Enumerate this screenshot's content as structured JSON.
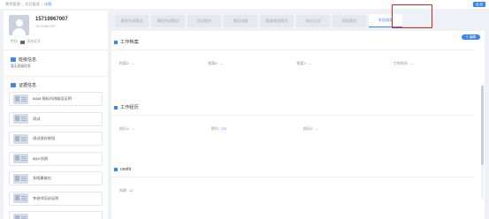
{
  "breadcrumb": [
    "教师管理",
    "学员管理",
    "详情"
  ],
  "top_button": "返 回",
  "profile": {
    "name": "15719967007",
    "phone": "15719967007",
    "gender_label": "性别",
    "tag": "身份证号"
  },
  "class_info": {
    "title": "班级信息",
    "value": "暂无班级信息"
  },
  "cert_info": {
    "title": "证据信息",
    "items": [
      "aqua 指标内测级培证明",
      "测试",
      "测试保存按钮",
      "aiya 执照",
      "多版属能也",
      "李老师培训证明",
      ""
    ]
  },
  "tabs": [
    "课表完成情况",
    "课程完成情况",
    "活动报名",
    "报证进展",
    "套餐使用情况",
    "岗位认证",
    "保险情况",
    "学员档案"
  ],
  "active_tab": 7,
  "edit_label": "编辑",
  "work_file": {
    "title": "工作档案",
    "fields": [
      {
        "label": "档案2:",
        "value": "---"
      },
      {
        "label": "档案4:",
        "value": "---"
      },
      {
        "label": "档案3:",
        "value": "---"
      },
      {
        "label": "工作时间:",
        "value": "---"
      }
    ]
  },
  "work_exp": {
    "title": "工作经历",
    "fields": [
      {
        "label": "经历1:",
        "value": "---"
      },
      {
        "label": "职位:",
        "value": "CG"
      },
      {
        "label": "经历2:",
        "value": "---"
      }
    ]
  },
  "ceshi": {
    "title": "ceshi",
    "fields": [
      {
        "label": "年龄:",
        "value": "12"
      }
    ]
  },
  "colors": {
    "accent": "#3e84f6",
    "highlight": "#e0201c"
  }
}
